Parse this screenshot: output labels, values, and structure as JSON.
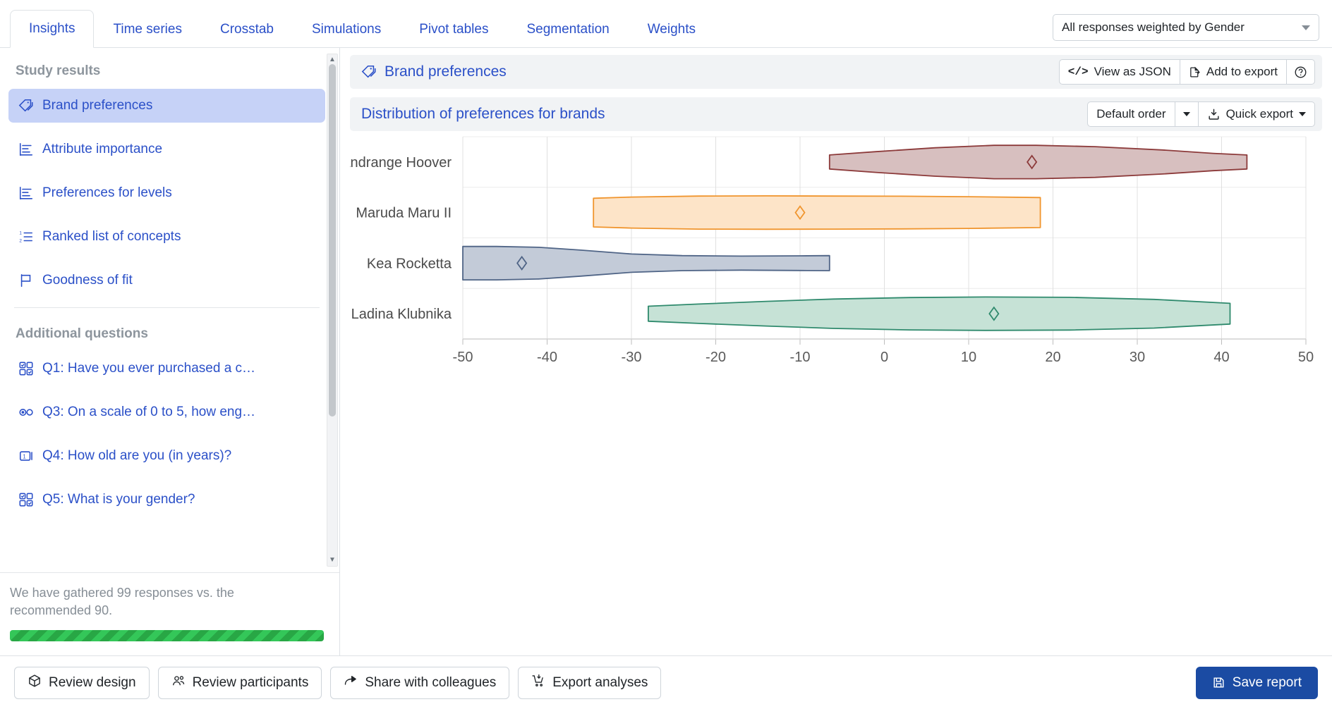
{
  "tabs": [
    {
      "label": "Insights",
      "active": true
    },
    {
      "label": "Time series",
      "active": false
    },
    {
      "label": "Crosstab",
      "active": false
    },
    {
      "label": "Simulations",
      "active": false
    },
    {
      "label": "Pivot tables",
      "active": false
    },
    {
      "label": "Segmentation",
      "active": false
    },
    {
      "label": "Weights",
      "active": false
    }
  ],
  "weight_filter": {
    "value": "All responses weighted by Gender",
    "icon": "chevron-down-icon"
  },
  "sidebar": {
    "study_results_title": "Study results",
    "study_results": [
      {
        "label": "Brand preferences",
        "icon": "tag-icon",
        "active": true
      },
      {
        "label": "Attribute importance",
        "icon": "bar-chart-icon",
        "active": false
      },
      {
        "label": "Preferences for levels",
        "icon": "bar-chart-icon",
        "active": false
      },
      {
        "label": "Ranked list of concepts",
        "icon": "ordered-list-icon",
        "active": false
      },
      {
        "label": "Goodness of fit",
        "icon": "flag-icon",
        "active": false
      }
    ],
    "additional_questions_title": "Additional questions",
    "additional_questions": [
      {
        "label": "Q1: Have you ever purchased a c…",
        "icon": "checkbox-grid-icon"
      },
      {
        "label": "Q3: On a scale of 0 to 5, how eng…",
        "icon": "radio-icon"
      },
      {
        "label": "Q4: How old are you (in years)?",
        "icon": "numeric-input-icon"
      },
      {
        "label": "Q5: What is your gender?",
        "icon": "checkbox-grid-icon"
      }
    ],
    "progress_text": "We have gathered 99 responses vs. the recommended 90.",
    "progress_color": "#2ea82e"
  },
  "panel": {
    "title": "Brand preferences",
    "title_icon": "tag-icon",
    "view_json_label": "View as JSON",
    "view_json_icon": "code-icon",
    "add_to_export_label": "Add to export",
    "add_to_export_icon": "export-file-icon",
    "help_icon": "question-circle-icon"
  },
  "chart_panel": {
    "title": "Distribution of preferences for brands",
    "order_label": "Default order",
    "order_caret_icon": "caret-down-icon",
    "quick_export_label": "Quick export",
    "quick_export_icon": "download-tray-icon",
    "quick_export_caret_icon": "caret-down-icon"
  },
  "chart_data": {
    "type": "violin",
    "title": "Distribution of preferences for brands",
    "xlabel": "",
    "ylabel": "",
    "xlim": [
      -50,
      50
    ],
    "xticks": [
      -50,
      -40,
      -30,
      -20,
      -10,
      0,
      10,
      20,
      30,
      40,
      50
    ],
    "xtick_labels": [
      "-50",
      "-40",
      "-30",
      "-20",
      "-10",
      "0",
      "10",
      "20",
      "30",
      "40",
      "50"
    ],
    "grid": true,
    "legend": "none",
    "categories": [
      "Landrange Hoover",
      "Maruda Maru II",
      "Kea Rocketta",
      "Ladina Klubnika"
    ],
    "series": [
      {
        "name": "Landrange Hoover",
        "color": "#8c3a3a",
        "fill": "#d7bfbf",
        "median": 17.5,
        "min": -6.5,
        "max": 43.0,
        "density": [
          {
            "x": -6.5,
            "w": 0.42
          },
          {
            "x": -1.0,
            "w": 0.62
          },
          {
            "x": 6.0,
            "w": 0.85
          },
          {
            "x": 13.0,
            "w": 1.0
          },
          {
            "x": 18.0,
            "w": 1.0
          },
          {
            "x": 25.0,
            "w": 0.92
          },
          {
            "x": 33.0,
            "w": 0.72
          },
          {
            "x": 39.0,
            "w": 0.52
          },
          {
            "x": 43.0,
            "w": 0.42
          }
        ]
      },
      {
        "name": "Maruda Maru II",
        "color": "#f0952e",
        "fill": "#fde4c8",
        "median": -10.0,
        "min": -34.5,
        "max": 18.5,
        "density": [
          {
            "x": -34.5,
            "w": 0.86
          },
          {
            "x": -30.0,
            "w": 0.93
          },
          {
            "x": -22.0,
            "w": 0.99
          },
          {
            "x": -14.0,
            "w": 1.0
          },
          {
            "x": -6.0,
            "w": 0.99
          },
          {
            "x": 2.0,
            "w": 0.98
          },
          {
            "x": 10.0,
            "w": 0.95
          },
          {
            "x": 18.5,
            "w": 0.9
          }
        ]
      },
      {
        "name": "Kea Rocketta",
        "color": "#4f6486",
        "fill": "#c3cbd8",
        "median": -43.0,
        "min": -50.0,
        "max": -6.5,
        "density": [
          {
            "x": -50.0,
            "w": 1.0
          },
          {
            "x": -46.0,
            "w": 1.0
          },
          {
            "x": -41.0,
            "w": 0.95
          },
          {
            "x": -36.0,
            "w": 0.78
          },
          {
            "x": -30.0,
            "w": 0.55
          },
          {
            "x": -24.0,
            "w": 0.45
          },
          {
            "x": -17.0,
            "w": 0.42
          },
          {
            "x": -10.0,
            "w": 0.44
          },
          {
            "x": -6.5,
            "w": 0.45
          }
        ]
      },
      {
        "name": "Ladina Klubnika",
        "color": "#2f8a6d",
        "fill": "#c6e2d6",
        "median": 13.0,
        "min": -28.0,
        "max": 41.0,
        "density": [
          {
            "x": -28.0,
            "w": 0.45
          },
          {
            "x": -22.0,
            "w": 0.58
          },
          {
            "x": -14.0,
            "w": 0.74
          },
          {
            "x": -6.0,
            "w": 0.88
          },
          {
            "x": 3.0,
            "w": 0.97
          },
          {
            "x": 12.0,
            "w": 1.0
          },
          {
            "x": 22.0,
            "w": 0.98
          },
          {
            "x": 32.0,
            "w": 0.86
          },
          {
            "x": 41.0,
            "w": 0.62
          }
        ]
      }
    ]
  },
  "footer": {
    "buttons": [
      {
        "label": "Review design",
        "icon": "cube-icon"
      },
      {
        "label": "Review participants",
        "icon": "people-icon"
      },
      {
        "label": "Share with colleagues",
        "icon": "share-icon"
      },
      {
        "label": "Export analyses",
        "icon": "cart-download-icon"
      }
    ],
    "save_label": "Save report",
    "save_icon": "save-disk-icon",
    "save_color": "#1b4ba3"
  }
}
